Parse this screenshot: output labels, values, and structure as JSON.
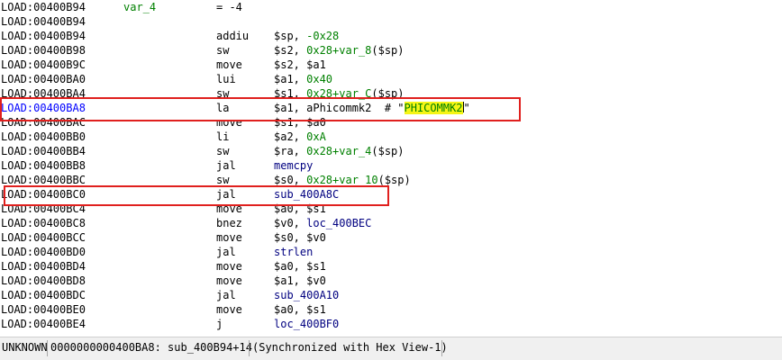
{
  "listing": {
    "rows": [
      {
        "addr": "LOAD:00400B94",
        "var": "var_4",
        "mnem": "= -4",
        "ops": []
      },
      {
        "addr": "LOAD:00400B94",
        "mnem": "",
        "ops": []
      },
      {
        "addr": "LOAD:00400B94",
        "mnem": "addiu",
        "ops": [
          {
            "t": "$sp, "
          },
          {
            "t": "-0x28",
            "c": "num"
          }
        ]
      },
      {
        "addr": "LOAD:00400B98",
        "mnem": "sw",
        "ops": [
          {
            "t": "$s2, "
          },
          {
            "t": "0x28+var_8",
            "c": "num"
          },
          {
            "t": "($sp)"
          }
        ]
      },
      {
        "addr": "LOAD:00400B9C",
        "mnem": "move",
        "ops": [
          {
            "t": "$s2, $a1"
          }
        ]
      },
      {
        "addr": "LOAD:00400BA0",
        "mnem": "lui",
        "ops": [
          {
            "t": "$a1, "
          },
          {
            "t": "0x40",
            "c": "num"
          }
        ]
      },
      {
        "addr": "LOAD:00400BA4",
        "mnem": "sw",
        "ops": [
          {
            "t": "$s1, "
          },
          {
            "t": "0x28+var_C",
            "c": "num"
          },
          {
            "t": "($sp)"
          }
        ]
      },
      {
        "addr": "LOAD:00400BA8",
        "current": true,
        "mnem": "la",
        "ops": [
          {
            "t": "$a1, aPhicommk2  # \""
          },
          {
            "t": "PHICOMMK2",
            "c": "strhl"
          },
          {
            "t": "\""
          }
        ]
      },
      {
        "addr": "LOAD:00400BAC",
        "mnem": "move",
        "ops": [
          {
            "t": "$s1, $a0"
          }
        ]
      },
      {
        "addr": "LOAD:00400BB0",
        "mnem": "li",
        "ops": [
          {
            "t": "$a2, "
          },
          {
            "t": "0xA",
            "c": "num"
          }
        ]
      },
      {
        "addr": "LOAD:00400BB4",
        "mnem": "sw",
        "ops": [
          {
            "t": "$ra, "
          },
          {
            "t": "0x28+var_4",
            "c": "num"
          },
          {
            "t": "($sp)"
          }
        ]
      },
      {
        "addr": "LOAD:00400BB8",
        "mnem": "jal",
        "ops": [
          {
            "t": "memcpy",
            "c": "sym"
          }
        ]
      },
      {
        "addr": "LOAD:00400BBC",
        "mnem": "sw",
        "ops": [
          {
            "t": "$s0, "
          },
          {
            "t": "0x28+var_10",
            "c": "num"
          },
          {
            "t": "($sp)"
          }
        ]
      },
      {
        "addr": "LOAD:00400BC0",
        "mnem": "jal",
        "ops": [
          {
            "t": "sub_400A8C",
            "c": "sym"
          }
        ]
      },
      {
        "addr": "LOAD:00400BC4",
        "mnem": "move",
        "ops": [
          {
            "t": "$a0, $s1"
          }
        ]
      },
      {
        "addr": "LOAD:00400BC8",
        "mnem": "bnez",
        "ops": [
          {
            "t": "$v0, "
          },
          {
            "t": "loc_400BEC",
            "c": "sym"
          }
        ]
      },
      {
        "addr": "LOAD:00400BCC",
        "mnem": "move",
        "ops": [
          {
            "t": "$s0, $v0"
          }
        ]
      },
      {
        "addr": "LOAD:00400BD0",
        "mnem": "jal",
        "ops": [
          {
            "t": "strlen",
            "c": "sym"
          }
        ]
      },
      {
        "addr": "LOAD:00400BD4",
        "mnem": "move",
        "ops": [
          {
            "t": "$a0, $s1"
          }
        ]
      },
      {
        "addr": "LOAD:00400BD8",
        "mnem": "move",
        "ops": [
          {
            "t": "$a1, $v0"
          }
        ]
      },
      {
        "addr": "LOAD:00400BDC",
        "mnem": "jal",
        "ops": [
          {
            "t": "sub_400A10",
            "c": "sym"
          }
        ]
      },
      {
        "addr": "LOAD:00400BE0",
        "mnem": "move",
        "ops": [
          {
            "t": "$a0, $s1"
          }
        ]
      },
      {
        "addr": "LOAD:00400BE4",
        "mnem": "j",
        "ops": [
          {
            "t": "loc_400BF0",
            "c": "sym"
          }
        ]
      }
    ]
  },
  "status": {
    "segment": "UNKNOWN",
    "location": "0000000000400BA8: sub_400B94+14",
    "sync": "(Synchronized with Hex View-1)"
  },
  "colors": {
    "highlight_box": "#e0201e",
    "number": "#008000",
    "current_address": "#0000ff",
    "string_highlight": "#f5f516"
  }
}
